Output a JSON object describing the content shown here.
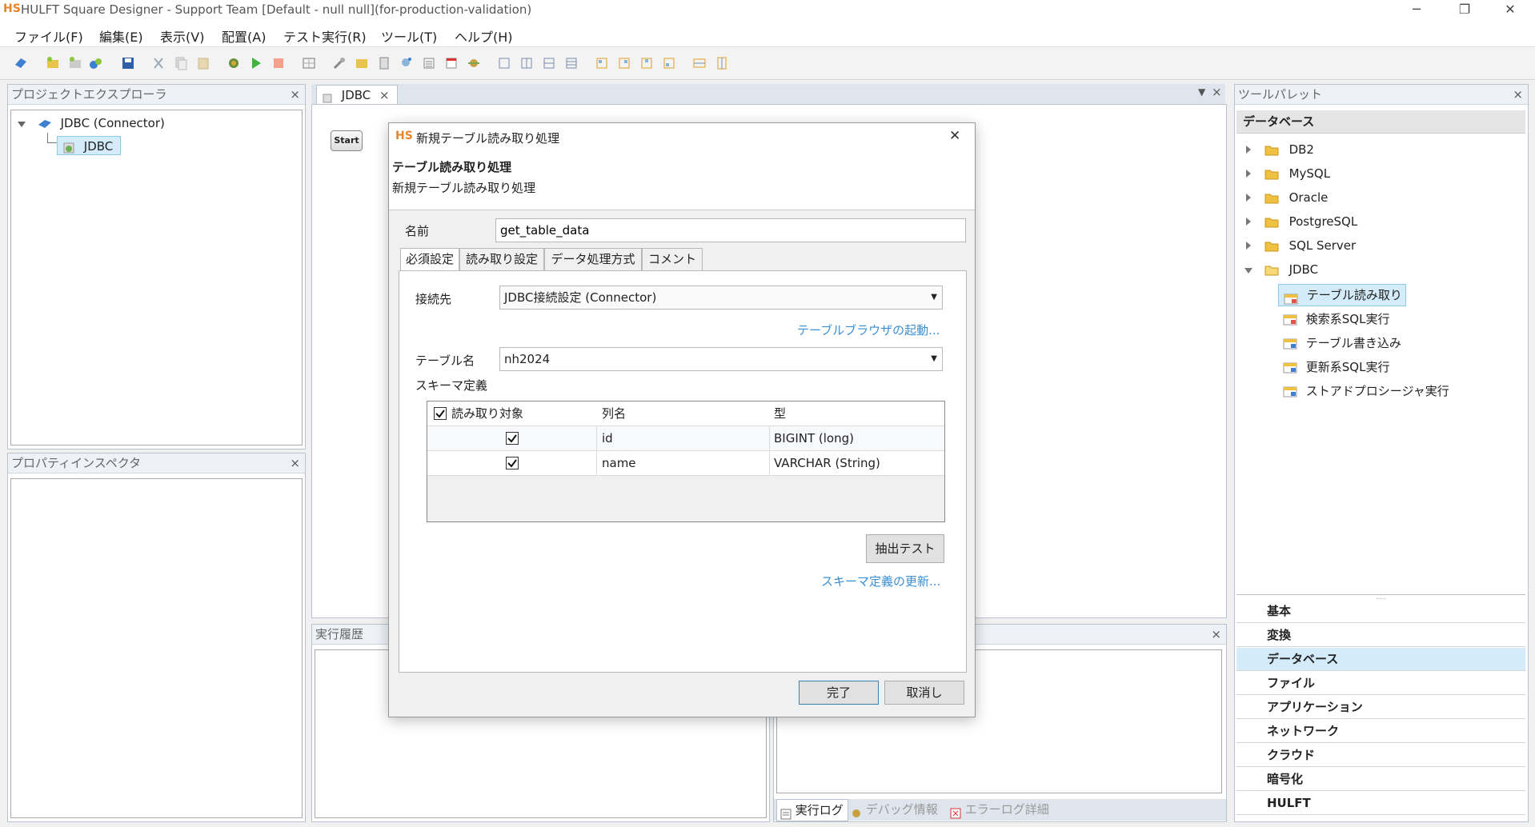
{
  "window": {
    "logo": "HS",
    "title": "HULFT Square Designer - Support Team [Default - null null](for-production-validation)",
    "minimize": "─",
    "restore": "❐",
    "close": "✕"
  },
  "menu": [
    "ファイル(F)",
    "編集(E)",
    "表示(V)",
    "配置(A)",
    "テスト実行(R)",
    "ツール(T)",
    "ヘルプ(H)"
  ],
  "project_explorer": {
    "title": "プロジェクトエクスプローラ",
    "close": "×",
    "root": "JDBC (Connector)",
    "child": "JDBC"
  },
  "property_inspector": {
    "title": "プロパティインスペクタ",
    "close": "×"
  },
  "editor": {
    "tab_label": "JDBC",
    "tab_close": "×",
    "start_label": "Start"
  },
  "history": {
    "title": "実行履歴",
    "close": "×"
  },
  "log": {
    "close": "×",
    "tabs": [
      "実行ログ",
      "デバッグ情報",
      "エラーログ詳細"
    ]
  },
  "palette": {
    "title": "ツールパレット",
    "close": "×",
    "section": "データベース",
    "folders": [
      "DB2",
      "MySQL",
      "Oracle",
      "PostgreSQL",
      "SQL Server",
      "JDBC"
    ],
    "jdbc_items": [
      "テーブル読み取り",
      "検索系SQL実行",
      "テーブル書き込み",
      "更新系SQL実行",
      "ストアドプロシージャ実行"
    ],
    "categories": [
      "基本",
      "変換",
      "データベース",
      "ファイル",
      "アプリケーション",
      "ネットワーク",
      "クラウド",
      "暗号化",
      "HULFT"
    ],
    "selected_category": "データベース"
  },
  "dialog": {
    "logo": "HS",
    "title": "新規テーブル読み取り処理",
    "close": "✕",
    "heading": "テーブル読み取り処理",
    "subheading": "新規テーブル読み取り処理",
    "name_label": "名前",
    "name_value": "get_table_data",
    "tabs": [
      "必須設定",
      "読み取り設定",
      "データ処理方式",
      "コメント"
    ],
    "connection_label": "接続先",
    "connection_value": "JDBC接続設定 (Connector)",
    "browser_link": "テーブルブラウザの起動...",
    "table_label": "テーブル名",
    "table_value": "nh2024",
    "schema_label": "スキーマ定義",
    "grid_headers": [
      "読み取り対象",
      "列名",
      "型"
    ],
    "grid_rows": [
      {
        "checked": true,
        "column": "id",
        "type": "BIGINT (long)"
      },
      {
        "checked": true,
        "column": "name",
        "type": "VARCHAR (String)"
      }
    ],
    "extract_button": "抽出テスト",
    "schema_update_link": "スキーマ定義の更新...",
    "ok_button": "完了",
    "cancel_button": "取消し"
  }
}
